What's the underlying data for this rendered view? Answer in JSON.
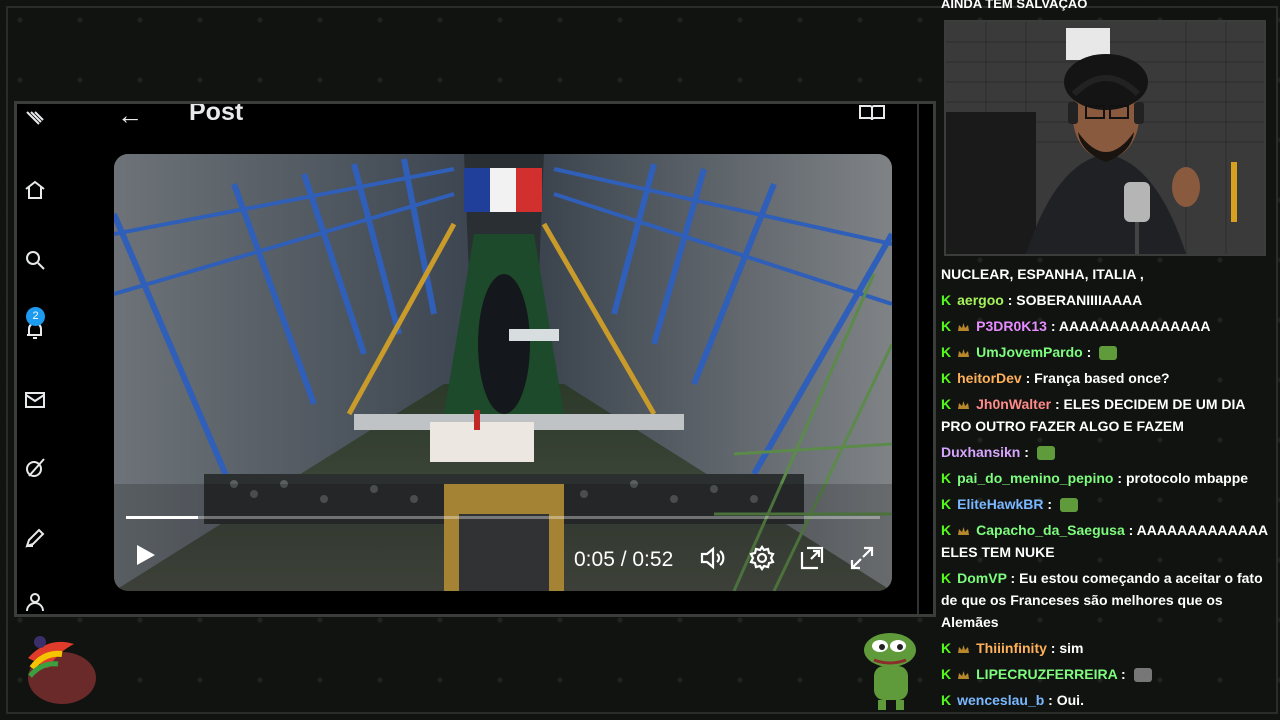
{
  "browser": {
    "post_header": {
      "back_icon": "arrow-left-icon",
      "title": "Post",
      "reader_icon": "reader-mode-icon"
    },
    "left_rail": {
      "icons": [
        "feather-icon",
        "home-icon",
        "search-icon",
        "notifications-icon",
        "messages-icon",
        "grok-icon",
        "compose-icon",
        "profile-icon"
      ],
      "notification_count": "2"
    },
    "video": {
      "time": "0:05 / 0:52",
      "progress": 0.096,
      "controls": [
        "play-icon",
        "volume-icon",
        "settings-icon",
        "picture-in-picture-icon",
        "fullscreen-icon"
      ]
    }
  },
  "chat": {
    "cut_top": "AINDA TEM SALVAÇÃO",
    "messages": [
      {
        "user": "",
        "text": "NUCLEAR, ESPANHA, ITALIA ,",
        "color": "#ffffff",
        "badges": []
      },
      {
        "user": "aergoo",
        "text": "SOBERANIIIIAAAA",
        "color": "#a6f25a",
        "badges": [
          "k"
        ]
      },
      {
        "user": "P3DR0K13",
        "text": "AAAAAAAAAAAAAAA",
        "color": "#e58cff",
        "badges": [
          "k",
          "crown"
        ]
      },
      {
        "user": "UmJovemPardo",
        "text": "",
        "color": "#7dfc7d",
        "badges": [
          "k",
          "crown"
        ],
        "emote": true
      },
      {
        "user": "heitorDev",
        "text": "França based once?",
        "color": "#ffb15a",
        "badges": [
          "k"
        ]
      },
      {
        "user": "Jh0nWalter",
        "text": "ELES DECIDEM DE UM DIA PRO OUTRO FAZER ALGO E FAZEM",
        "color": "#ff8a8a",
        "badges": [
          "k",
          "crown"
        ]
      },
      {
        "user": "Duxhansikn",
        "text": "",
        "color": "#d6a6ff",
        "badges": [],
        "emote": true
      },
      {
        "user": "pai_do_menino_pepino",
        "text": "protocolo mbappe",
        "color": "#7dfc7d",
        "badges": [
          "k"
        ]
      },
      {
        "user": "EliteHawkBR",
        "text": "",
        "color": "#7ab8ff",
        "badges": [
          "k"
        ],
        "emote": true
      },
      {
        "user": "Capacho_da_Saegusa",
        "text": "AAAAAAAAAAAAA ELES TEM NUKE",
        "color": "#7dfc7d",
        "badges": [
          "k",
          "crown"
        ]
      },
      {
        "user": "DomVP",
        "text": "Eu estou começando a aceitar o fato de que os Franceses são melhores que os Alemães",
        "color": "#7dfc7d",
        "badges": [
          "k"
        ]
      },
      {
        "user": "Thiiinfinity",
        "text": "sim",
        "color": "#ffb15a",
        "badges": [
          "k",
          "crown"
        ]
      },
      {
        "user": "LIPECRUZFERREIRA",
        "text": "",
        "color": "#7dfc7d",
        "badges": [
          "k",
          "crown"
        ],
        "emote": true
      },
      {
        "user": "wenceslau_b",
        "text": "Oui.",
        "color": "#7ab8ff",
        "badges": [
          "k"
        ]
      }
    ]
  },
  "colors": {
    "kick_green": "#53fc18",
    "twitter_blue": "#1d9bf0"
  }
}
